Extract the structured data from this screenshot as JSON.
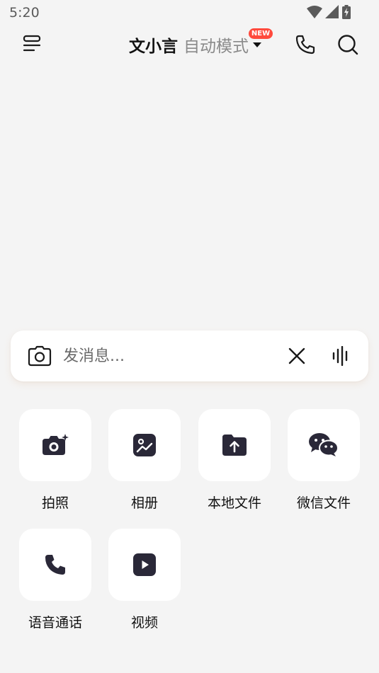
{
  "status_bar": {
    "time": "5:20"
  },
  "header": {
    "title": "文小言",
    "mode": "自动模式",
    "badge": "NEW"
  },
  "input": {
    "placeholder": "发消息..."
  },
  "actions": [
    {
      "label": "拍照"
    },
    {
      "label": "相册"
    },
    {
      "label": "本地文件"
    },
    {
      "label": "微信文件"
    },
    {
      "label": "语音通话"
    },
    {
      "label": "视频"
    }
  ],
  "colors": {
    "background": "#f4f4f4",
    "tile": "#ffffff",
    "icon_dark": "#2a2838",
    "badge": "#ff4a3d"
  }
}
